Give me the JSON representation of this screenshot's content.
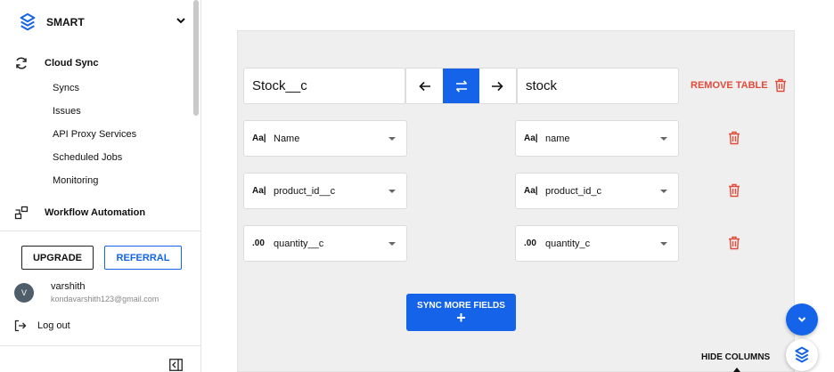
{
  "sidebar": {
    "brand": "SMART",
    "nav": [
      {
        "label": "Cloud Sync",
        "icon": "sync-icon"
      },
      {
        "label": "Workflow Automation",
        "icon": "workflow-icon"
      }
    ],
    "cloud_sync_items": [
      "Syncs",
      "Issues",
      "API Proxy Services",
      "Scheduled Jobs",
      "Monitoring"
    ],
    "upgrade_label": "UPGRADE",
    "referral_label": "REFERRAL",
    "user": {
      "initial": "V",
      "name": "varshith",
      "email": "kondavarshith123@gmail.com"
    },
    "logout_label": "Log out"
  },
  "mapping": {
    "source_table": "Stock__c",
    "target_table": "stock",
    "remove_table_label": "REMOVE TABLE",
    "rows": [
      {
        "source_icon": "Aa|",
        "source": "Name",
        "target_icon": "Aa|",
        "target": "name"
      },
      {
        "source_icon": "Aa|",
        "source": "product_id__c",
        "target_icon": "Aa|",
        "target": "product_id_c"
      },
      {
        "source_icon": ".00",
        "source": "quantity__c",
        "target_icon": ".00",
        "target": "quantity_c"
      }
    ],
    "sync_more_label": "SYNC MORE FIELDS",
    "sync_more_plus": "+",
    "hide_columns_label": "HIDE COLUMNS"
  },
  "colors": {
    "accent": "#1463e8",
    "danger": "#e04b3c",
    "panel_bg": "#efefef"
  }
}
